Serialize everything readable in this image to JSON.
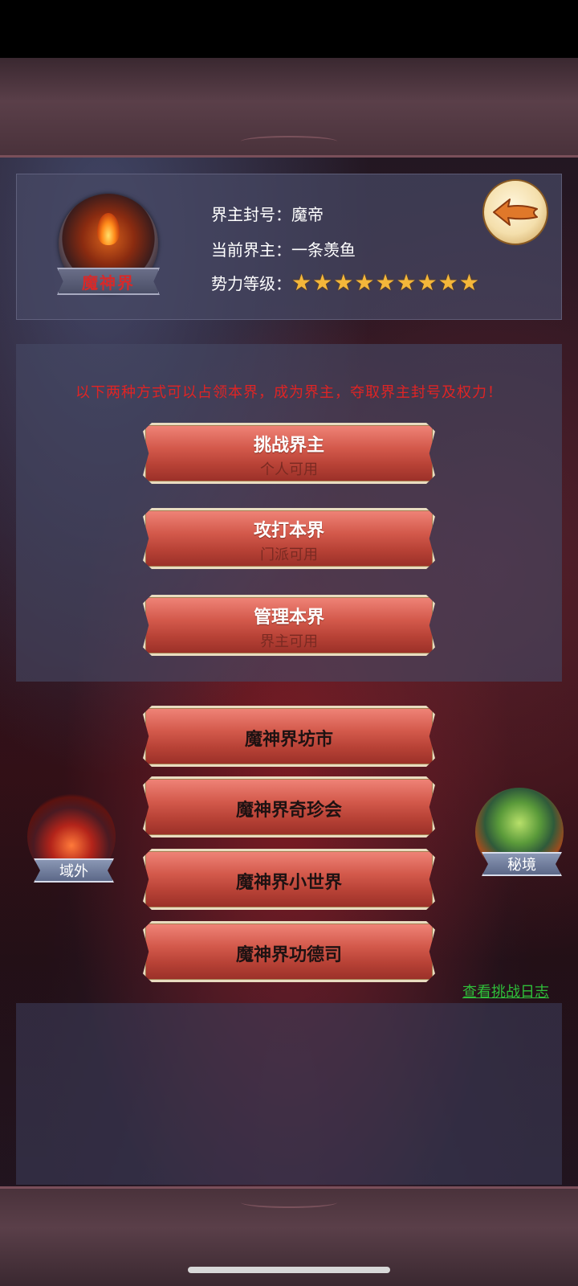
{
  "info": {
    "emblem_name": "魔神界",
    "title_label": "界主封号：",
    "title_value": "魔帝",
    "lord_label": "当前界主：",
    "lord_value": "一条羡鱼",
    "level_label": "势力等级：",
    "level_stars": 9,
    "star_glyph": "★"
  },
  "notice": {
    "text": "以下两种方式可以占领本界，成为界主，夺取界主封号及权力！"
  },
  "actions": [
    {
      "title": "挑战界主",
      "sub": "个人可用"
    },
    {
      "title": "攻打本界",
      "sub": "门派可用"
    },
    {
      "title": "管理本界",
      "sub": "界主可用"
    }
  ],
  "menu": [
    {
      "title": "魔神界坊市"
    },
    {
      "title": "魔神界奇珍会"
    },
    {
      "title": "魔神界小世界"
    },
    {
      "title": "魔神界功德司"
    }
  ],
  "portals": {
    "left": "域外",
    "right": "秘境"
  },
  "log_link": "查看挑战日志",
  "colors": {
    "notice_red": "#e02424",
    "link_green": "#2fbf3a",
    "star_gold": "#f4b73a",
    "button_red": "#d45a4c"
  },
  "icons": {
    "back": "back-arrow-icon",
    "star": "star-icon"
  }
}
